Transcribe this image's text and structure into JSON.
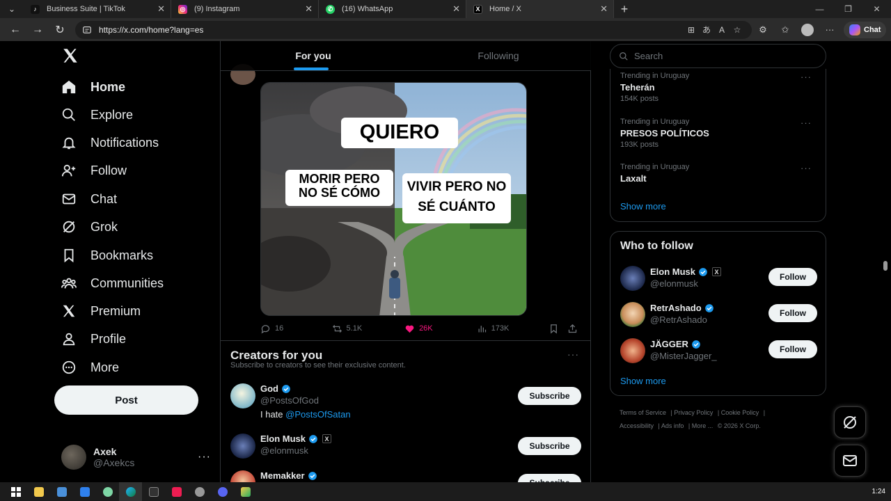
{
  "browser": {
    "tabs": [
      {
        "label": "Business Suite | TikTok",
        "icon": "tiktok-icon"
      },
      {
        "label": "(9) Instagram",
        "icon": "instagram-icon"
      },
      {
        "label": "(16) WhatsApp",
        "icon": "whatsapp-icon"
      },
      {
        "label": "Home / X",
        "icon": "x-icon"
      }
    ],
    "url": "https://x.com/home?lang=es",
    "chat_label": "Chat"
  },
  "nav": {
    "items": [
      {
        "label": "Home",
        "icon": "home-icon"
      },
      {
        "label": "Explore",
        "icon": "search-icon"
      },
      {
        "label": "Notifications",
        "icon": "bell-icon"
      },
      {
        "label": "Follow",
        "icon": "person-add-icon"
      },
      {
        "label": "Chat",
        "icon": "mail-icon"
      },
      {
        "label": "Grok",
        "icon": "grok-icon"
      },
      {
        "label": "Bookmarks",
        "icon": "bookmark-icon"
      },
      {
        "label": "Communities",
        "icon": "communities-icon"
      },
      {
        "label": "Premium",
        "icon": "x-icon"
      },
      {
        "label": "Profile",
        "icon": "profile-icon"
      },
      {
        "label": "More",
        "icon": "more-circle-icon"
      }
    ],
    "post_label": "Post",
    "user": {
      "name": "Axek",
      "handle": "@Axekcs"
    }
  },
  "feed": {
    "tabs": [
      "For you",
      "Following"
    ],
    "post": {
      "meme": {
        "top": "QUIERO",
        "left": "MORIR PERO NO SÉ CÓMO",
        "right": "VIVIR PERO NO SÉ CUÁNTO"
      },
      "replies": "16",
      "reposts": "5.1K",
      "likes": "26K",
      "views": "173K"
    },
    "creators": {
      "title": "Creators for you",
      "subtitle": "Subscribe to creators to see their exclusive content.",
      "items": [
        {
          "name": "God",
          "handle": "@PostsOfGod",
          "bio_prefix": "I hate ",
          "bio_mention": "@PostsOfSatan",
          "button": "Subscribe"
        },
        {
          "name": "Elon Musk",
          "handle": "@elonmusk",
          "button": "Subscribe"
        },
        {
          "name": "Memakker",
          "button": "Subscribe"
        }
      ]
    }
  },
  "sidebar": {
    "search_placeholder": "Search",
    "trends": [
      {
        "context": "Trending in Uruguay",
        "name": "Teherán",
        "posts": "154K posts"
      },
      {
        "context": "Trending in Uruguay",
        "name": "PRESOS POLÍTICOS",
        "posts": "193K posts"
      },
      {
        "context": "Trending in Uruguay",
        "name": "Laxalt"
      }
    ],
    "show_more": "Show more",
    "who_to_follow": {
      "title": "Who to follow",
      "items": [
        {
          "name": "Elon Musk",
          "handle": "@elonmusk",
          "button": "Follow"
        },
        {
          "name": "RetrAshado",
          "handle": "@RetrAshado",
          "button": "Follow"
        },
        {
          "name": "JÄGGER",
          "handle": "@MisterJagger_",
          "button": "Follow"
        }
      ],
      "show_more": "Show more"
    },
    "footer": [
      "Terms of Service",
      "Privacy Policy",
      "Cookie Policy",
      "Accessibility",
      "Ads info",
      "More ...",
      "© 2026 X Corp."
    ]
  },
  "taskbar": {
    "clock": "1:24"
  },
  "colors": {
    "accent": "#1d9bf0",
    "like": "#f91880",
    "background": "#000000"
  }
}
